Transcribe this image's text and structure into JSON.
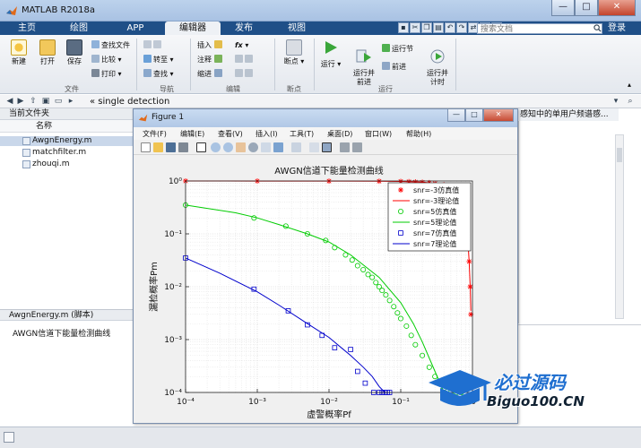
{
  "window": {
    "title": "MATLAB R2018a",
    "minimize": "—",
    "restore": "□",
    "close": "✕"
  },
  "tabs": [
    {
      "label": "主页"
    },
    {
      "label": "绘图"
    },
    {
      "label": "APP"
    },
    {
      "label": "编辑器"
    },
    {
      "label": "发布"
    },
    {
      "label": "视图"
    }
  ],
  "search": {
    "placeholder": "搜索文档"
  },
  "login": "登录",
  "ribbon": {
    "file": {
      "new": "新建",
      "open": "打开",
      "save": "保存",
      "find_files": "查找文件",
      "compare": "比较",
      "print": "打印",
      "group": "文件"
    },
    "nav": {
      "goto": "转至",
      "find": "查找",
      "group": "导航"
    },
    "edit": {
      "insert": "插入",
      "comment": "注释",
      "indent": "缩进",
      "fx": "fx",
      "group": "编辑"
    },
    "breakpoints": {
      "breakpoint": "断点",
      "group": "断点"
    },
    "run": {
      "run": "运行",
      "run_advance": "运行并\n前进",
      "run_section": "运行节",
      "advance": "前进",
      "run_time": "运行并\n计时",
      "group": "运行"
    }
  },
  "path": {
    "text": "« single detection"
  },
  "current_folder": {
    "title": "当前文件夹",
    "col_name": "名称",
    "files": [
      {
        "name": "AwgnEnergy.m",
        "selected": true
      },
      {
        "name": "matchfilter.m",
        "selected": false
      },
      {
        "name": "zhouqi.m",
        "selected": false
      }
    ]
  },
  "details": {
    "title": "AwgnEnergy.m  (脚本)",
    "text": "AWGN信道下能量检测曲线"
  },
  "editor_tab": "感知中的单用户频谱感...",
  "figure": {
    "title": "Figure 1",
    "menu": [
      "文件(F)",
      "编辑(E)",
      "查看(V)",
      "插入(I)",
      "工具(T)",
      "桌面(D)",
      "窗口(W)",
      "帮助(H)"
    ]
  },
  "chart_data": {
    "type": "line",
    "title": "AWGN信道下能量检测曲线",
    "xlabel": "虚警概率Pf",
    "ylabel": "漏检概率Pm",
    "xscale": "log",
    "yscale": "log",
    "xlim": [
      0.0001,
      1
    ],
    "ylim": [
      0.0001,
      1
    ],
    "xticks": [
      "10⁻⁴",
      "10⁻³",
      "10⁻²",
      "10⁻¹",
      "10⁰"
    ],
    "yticks": [
      "10⁰",
      "10⁻¹",
      "10⁻²",
      "10⁻³",
      "10⁻⁴"
    ],
    "grid": true,
    "legend_position": "top-right",
    "series": [
      {
        "name": "snr=-3仿真值",
        "kind": "marker",
        "marker": "*",
        "color": "#ff0000",
        "x": [
          0.0001,
          0.001,
          0.01,
          0.05,
          0.1,
          0.13,
          0.16,
          0.2,
          0.25,
          0.3,
          0.4,
          0.5,
          0.6,
          0.7,
          0.75,
          0.8,
          0.85,
          0.9,
          0.93,
          0.95
        ],
        "y": [
          0.999,
          0.998,
          0.995,
          0.99,
          0.98,
          0.97,
          0.96,
          0.95,
          0.93,
          0.9,
          0.85,
          0.8,
          0.7,
          0.5,
          0.35,
          0.2,
          0.1,
          0.03,
          0.01,
          0.003
        ]
      },
      {
        "name": "snr=-3理论值",
        "kind": "line",
        "color": "#ff0000",
        "x": [
          0.0001,
          0.001,
          0.01,
          0.05,
          0.1,
          0.2,
          0.3,
          0.4,
          0.5,
          0.6,
          0.7,
          0.8,
          0.85,
          0.9,
          0.93,
          0.95
        ],
        "y": [
          0.999,
          0.998,
          0.995,
          0.99,
          0.98,
          0.95,
          0.9,
          0.85,
          0.8,
          0.7,
          0.5,
          0.2,
          0.1,
          0.03,
          0.01,
          0.0035
        ]
      },
      {
        "name": "snr=5仿真值",
        "kind": "marker",
        "marker": "o",
        "color": "#00cc00",
        "x": [
          0.0001,
          0.0009,
          0.0025,
          0.005,
          0.009,
          0.012,
          0.017,
          0.021,
          0.025,
          0.03,
          0.035,
          0.04,
          0.045,
          0.05,
          0.055,
          0.062,
          0.07,
          0.08,
          0.09,
          0.1,
          0.12,
          0.14,
          0.16,
          0.2,
          0.25,
          0.3,
          0.35,
          0.4,
          0.5,
          0.6,
          0.7
        ],
        "y": [
          0.35,
          0.2,
          0.14,
          0.1,
          0.075,
          0.055,
          0.04,
          0.032,
          0.025,
          0.021,
          0.017,
          0.015,
          0.012,
          0.01,
          0.0085,
          0.007,
          0.0055,
          0.0042,
          0.0032,
          0.0025,
          0.0018,
          0.0012,
          0.0008,
          0.0005,
          0.0003,
          0.0002,
          0.00015,
          0.00012,
          0.0001,
          0.0001,
          0.0001
        ]
      },
      {
        "name": "snr=5理论值",
        "kind": "line",
        "color": "#00cc00",
        "x": [
          0.0001,
          0.0005,
          0.001,
          0.002,
          0.005,
          0.01,
          0.02,
          0.05,
          0.1,
          0.15,
          0.2,
          0.3,
          0.4
        ],
        "y": [
          0.35,
          0.25,
          0.2,
          0.15,
          0.1,
          0.07,
          0.04,
          0.015,
          0.005,
          0.002,
          0.0009,
          0.00025,
          0.0001
        ]
      },
      {
        "name": "snr=7仿真值",
        "kind": "marker",
        "marker": "s",
        "color": "#0000cc",
        "x": [
          0.0001,
          0.0009,
          0.0027,
          0.005,
          0.008,
          0.012,
          0.02,
          0.025,
          0.032,
          0.042,
          0.05,
          0.055,
          0.06,
          0.065,
          0.07
        ],
        "y": [
          0.035,
          0.009,
          0.0035,
          0.0019,
          0.0012,
          0.0007,
          0.00065,
          0.00025,
          0.00015,
          0.0001,
          0.0001,
          0.0001,
          0.0001,
          0.0001,
          0.0001
        ]
      },
      {
        "name": "snr=7理论值",
        "kind": "line",
        "color": "#0000cc",
        "x": [
          0.0001,
          0.0003,
          0.001,
          0.002,
          0.005,
          0.01,
          0.02,
          0.03,
          0.04,
          0.05,
          0.06
        ],
        "y": [
          0.035,
          0.018,
          0.008,
          0.0045,
          0.002,
          0.0011,
          0.0005,
          0.0003,
          0.0002,
          0.00013,
          0.0001
        ]
      }
    ]
  },
  "watermark": {
    "line1": "必过源码",
    "line2": "Biguo100.CN"
  }
}
